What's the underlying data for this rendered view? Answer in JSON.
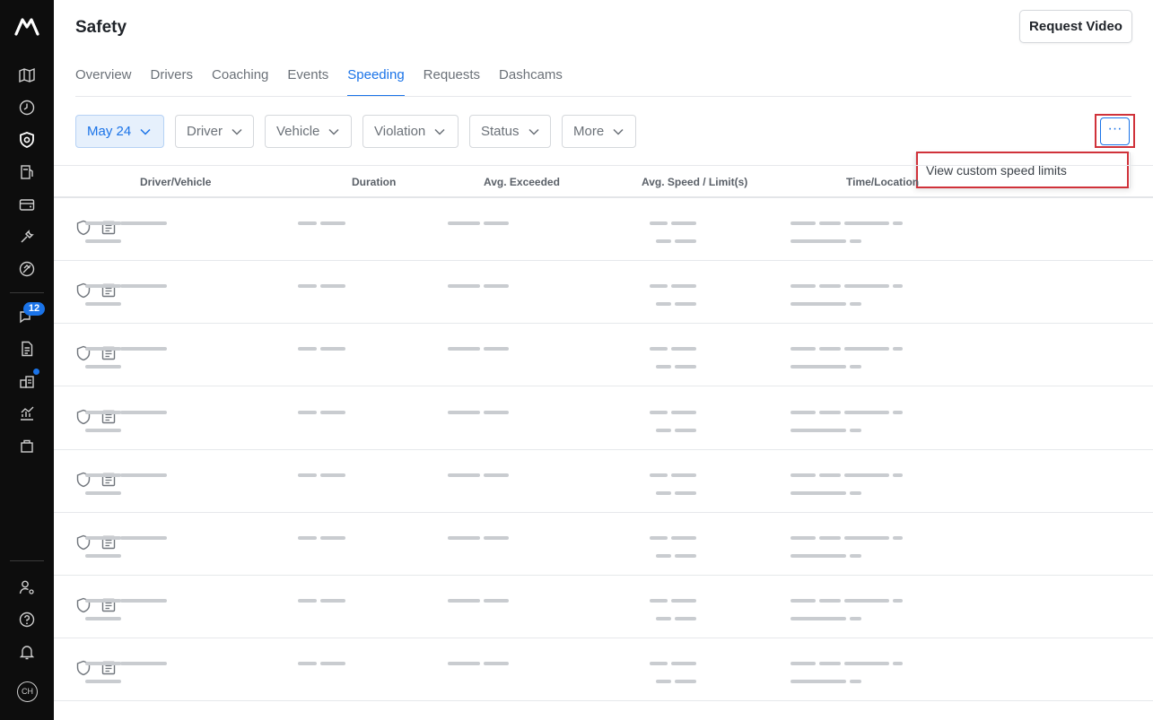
{
  "page": {
    "title": "Safety"
  },
  "header": {
    "request_video_label": "Request Video"
  },
  "tabs": [
    {
      "label": "Overview",
      "active": false
    },
    {
      "label": "Drivers",
      "active": false
    },
    {
      "label": "Coaching",
      "active": false
    },
    {
      "label": "Events",
      "active": false
    },
    {
      "label": "Speeding",
      "active": true
    },
    {
      "label": "Requests",
      "active": false
    },
    {
      "label": "Dashcams",
      "active": false
    }
  ],
  "filters": {
    "date": "May 24",
    "driver": "Driver",
    "vehicle": "Vehicle",
    "violation": "Violation",
    "status": "Status",
    "more": "More"
  },
  "more_menu": {
    "button_label": "···",
    "items": [
      "View custom speed limits"
    ]
  },
  "table": {
    "columns": [
      "Driver/Vehicle",
      "Duration",
      "Avg. Exceeded",
      "Avg. Speed / Limit(s)",
      "Time/Location"
    ],
    "row_count": 8
  },
  "sidebar": {
    "notifications_badge": "12",
    "avatar_initials": "CH",
    "icons": [
      "map-icon",
      "clock-icon",
      "shield-icon",
      "fuel-icon",
      "wallet-icon",
      "wrench-icon",
      "compliance-icon",
      "messages-icon",
      "document-icon",
      "apps-icon",
      "analytics-icon",
      "bag-icon",
      "user-settings-icon",
      "help-icon",
      "bell-icon"
    ]
  },
  "colors": {
    "accent": "#1a73e8",
    "highlight": "#d0323a",
    "sidebar": "#0d0d0d"
  }
}
